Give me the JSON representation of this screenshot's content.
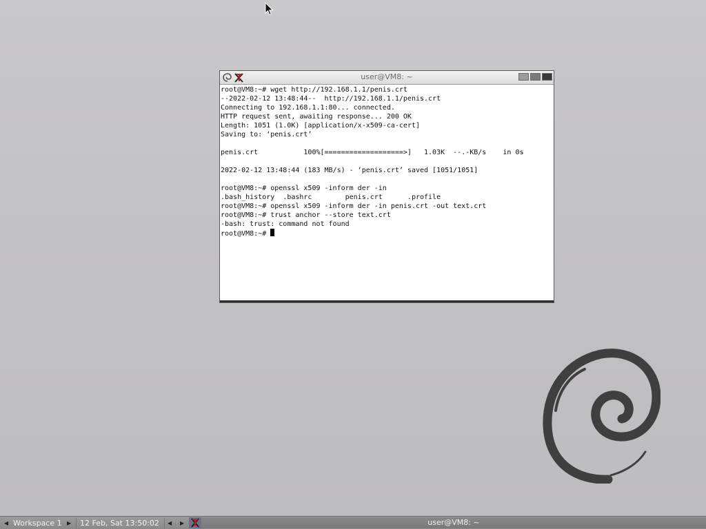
{
  "terminal": {
    "title": "user@VM8: ~",
    "lines": [
      "root@VM8:~# wget http://192.168.1.1/penis.crt",
      "--2022-02-12 13:48:44--  http://192.168.1.1/penis.crt",
      "Connecting to 192.168.1.1:80... connected.",
      "HTTP request sent, awaiting response... 200 OK",
      "Length: 1051 (1.0K) [application/x-x509-ca-cert]",
      "Saving to: ‘penis.crt’",
      "",
      "penis.crt           100%[===================>]   1.03K  --.-KB/s    in 0s",
      "",
      "2022-02-12 13:48:44 (183 MB/s) - ‘penis.crt’ saved [1051/1051]",
      "",
      "root@VM8:~# openssl x509 -inform der -in",
      ".bash_history  .bashrc        penis.crt      .profile",
      "root@VM8:~# openssl x509 -inform der -in penis.crt -out text.crt",
      "root@VM8:~# trust anchor --store text.crt",
      "-bash: trust: command not found"
    ],
    "prompt": "root@VM8:~# "
  },
  "taskbar": {
    "workspace": "Workspace 1",
    "clock": "12 Feb, Sat 13:50:02",
    "task_title": "user@VM8: ~"
  },
  "icons": {
    "cursor": "mouse-pointer-icon",
    "debian": "debian-swirl-icon",
    "xterm": "xterm-icon"
  },
  "colors": {
    "desktop": "#c4c3c5",
    "taskbar": "#8e8e8e",
    "terminal_bg": "#ffffff",
    "debian_logo": "#3f3f3f",
    "xterm_red": "#b0202a"
  }
}
